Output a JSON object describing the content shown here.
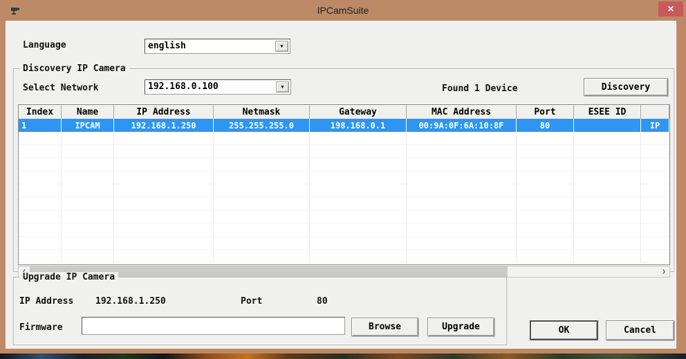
{
  "window": {
    "title": "IPCamSuite",
    "close_glyph": "✕"
  },
  "language": {
    "label": "Language",
    "value": "english"
  },
  "discovery": {
    "group_label": "Discovery IP Camera",
    "select_network_label": "Select Network",
    "network_value": "192.168.0.100",
    "found_text": "Found 1 Device",
    "discovery_button": "Discovery",
    "table": {
      "columns": [
        "Index",
        "Name",
        "IP Address",
        "Netmask",
        "Gateway",
        "MAC Address",
        "Port",
        "ESEE ID",
        ""
      ],
      "rows": [
        [
          "1",
          "IPCAM",
          "192.168.1.250",
          "255.255.255.0",
          "198.168.0.1",
          "00:9A:0F:6A:10:8F",
          "80",
          "",
          "IP"
        ]
      ]
    }
  },
  "upgrade": {
    "group_label": "Upgrade IP Camera",
    "ip_label": "IP Address",
    "ip_value": "192.168.1.250",
    "port_label": "Port",
    "port_value": "80",
    "firmware_label": "Firmware",
    "firmware_value": "",
    "browse_button": "Browse",
    "upgrade_button": "Upgrade"
  },
  "actions": {
    "ok": "OK",
    "cancel": "Cancel"
  },
  "colors": {
    "titlebar": "#bd8a68",
    "close_button": "#c85a5e",
    "selected_row": "#2e96f2",
    "content_bg": "#f0f0ee"
  }
}
